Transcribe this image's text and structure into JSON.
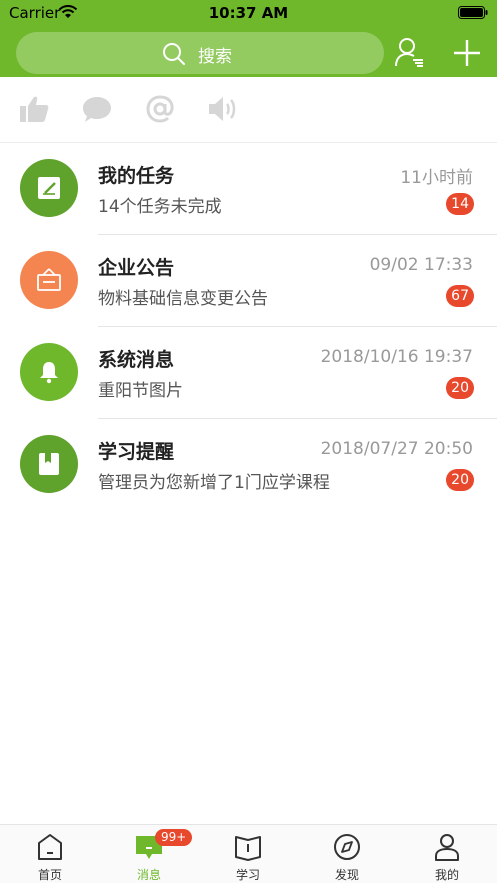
{
  "colors": {
    "brand": "#6fb82b",
    "badge": "#e8482c",
    "muted_icon": "#d6d6d6"
  },
  "status_bar": {
    "carrier": "Carrier",
    "time": "10:37 AM"
  },
  "nav": {
    "search_placeholder": "搜索"
  },
  "quick_icons": [
    "thumbs-up-icon",
    "comment-icon",
    "at-mention-icon",
    "speaker-icon"
  ],
  "messages": [
    {
      "title": "我的任务",
      "time": "11小时前",
      "preview": "14个任务未完成",
      "badge": "14",
      "icon": "task-edit-icon",
      "color": "#5fa22c"
    },
    {
      "title": "企业公告",
      "time": "09/02 17:33",
      "preview": "物料基础信息变更公告",
      "badge": "67",
      "icon": "notice-board-icon",
      "color": "#f58550"
    },
    {
      "title": "系统消息",
      "time": "2018/10/16 19:37",
      "preview": "重阳节图片",
      "badge": "20",
      "icon": "bell-icon",
      "color": "#6fb82b"
    },
    {
      "title": "学习提醒",
      "time": "2018/07/27 20:50",
      "preview": "管理员为您新增了1门应学课程",
      "badge": "20",
      "icon": "book-icon",
      "color": "#5fa22c"
    }
  ],
  "tabs": [
    {
      "label": "首页",
      "icon": "home-icon",
      "active": false
    },
    {
      "label": "消息",
      "icon": "message-icon",
      "active": true,
      "badge": "99+"
    },
    {
      "label": "学习",
      "icon": "open-book-icon",
      "active": false
    },
    {
      "label": "发现",
      "icon": "compass-icon",
      "active": false
    },
    {
      "label": "我的",
      "icon": "profile-icon",
      "active": false
    }
  ]
}
